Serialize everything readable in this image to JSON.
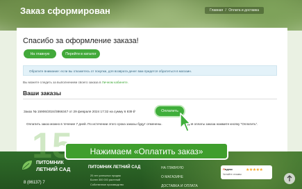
{
  "header": {
    "title": "Заказ сформирован",
    "breadcrumbs": [
      "Главная",
      "/",
      "Оплата и доставка"
    ]
  },
  "thanks": {
    "title": "Спасибо за оформление заказа!",
    "home_button": "На главную",
    "catalog_button": "Перейти в каталог"
  },
  "notice": "Обратите внимание: если вы откажетесь от покупки, для возврата денег вам придется обратиться в магазин.",
  "tracking": {
    "text": "Вы можете следить за выполнением своего заказа в ",
    "link": "Личном кабинете."
  },
  "orders": {
    "title": "Ваши заказы",
    "order_line": "Заказ № 15906/2024/3866347 от 29 февраля 2024 17:32 на сумму 6 839 ₽",
    "pay_button": "Оплатить",
    "pay_info": "Оплатить заказ можно в течение 7 дней. По истечении этого срока заказы будут отменены.",
    "pay_tip": "Для оплаты заказа нажмите кнопку \"Оплатить\"."
  },
  "caption": "Нажимаем «Оплатить заказ»",
  "footer": {
    "big_number": "15",
    "logo_line1": "ПИТОМНИК",
    "logo_line2": "ЛЕТНИЙ САД",
    "company": "ПИТОМНИК ЛЕТНИЙ САД",
    "links": [
      "20 лет успешных продаж",
      "Более 300 000 растений",
      "Собственное производство"
    ],
    "nav_home": "НА ГЛАВНУЮ",
    "nav_shop": "О МАГАЗИНЕ",
    "nav_delivery": "ДОСТАВКА И ОПЛАТА",
    "phone": "8 (86137) 7",
    "yandex_brand_y": "Я",
    "yandex_brand_rest": "ндекс",
    "yandex_rating_stars": "★★★★★",
    "yandex_row": "Читайте отзывы"
  },
  "colors": {
    "accent": "#42a93a",
    "notice_bg": "#e3f2f9",
    "footer_bg": "#2f6d2a"
  },
  "icons": {
    "cursor": "hand-pointer-icon",
    "scroll_up": "arrow-up-icon"
  }
}
